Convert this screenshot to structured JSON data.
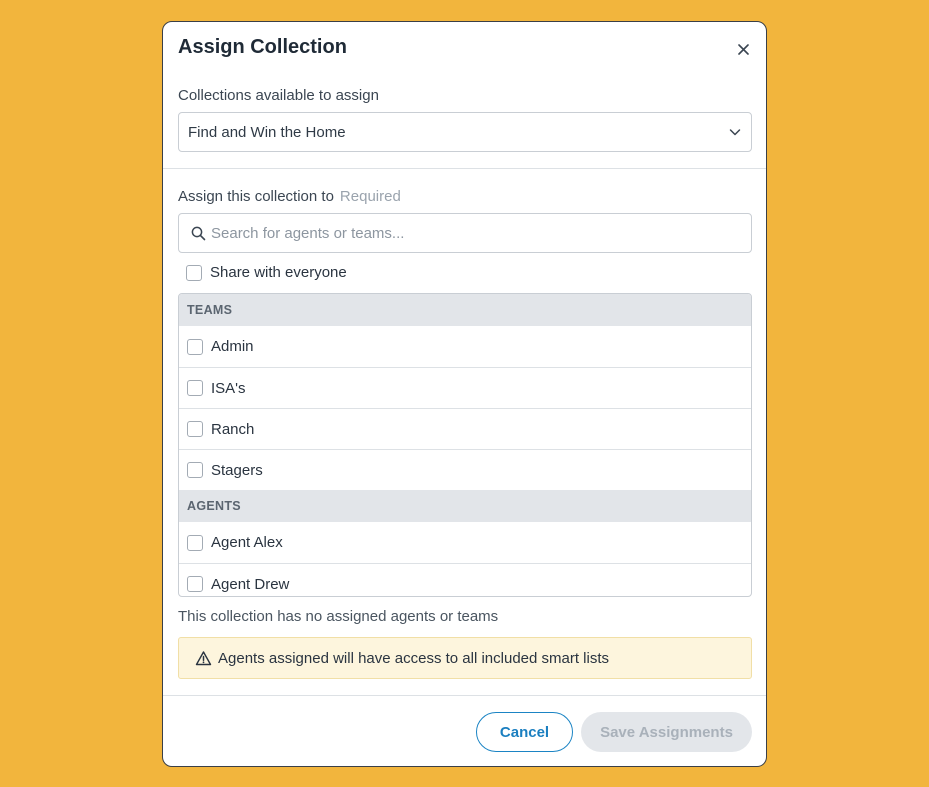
{
  "modal": {
    "title": "Assign Collection",
    "close_icon": "close-icon"
  },
  "collection_select": {
    "label": "Collections available to assign",
    "value": "Find and Win the Home",
    "icon": "chevron-down-icon"
  },
  "assign": {
    "label": "Assign this collection to",
    "required": "Required",
    "search_placeholder": "Search for agents or teams...",
    "search_value": "",
    "search_icon": "search-icon",
    "share_label": "Share with everyone"
  },
  "teams": {
    "header": "TEAMS",
    "items": [
      {
        "label": "Admin",
        "checked": false
      },
      {
        "label": "ISA's",
        "checked": false
      },
      {
        "label": "Ranch",
        "checked": false
      },
      {
        "label": "Stagers",
        "checked": false
      }
    ]
  },
  "agents": {
    "header": "AGENTS",
    "items": [
      {
        "label": "Agent Alex",
        "checked": false
      },
      {
        "label": "Agent Drew",
        "checked": false
      }
    ]
  },
  "status_text": "This collection has no assigned agents or teams",
  "warning": {
    "icon": "warning-icon",
    "text": "Agents assigned will have access to all included smart lists"
  },
  "footer": {
    "cancel_label": "Cancel",
    "save_label": "Save Assignments",
    "save_disabled": true
  },
  "colors": {
    "background": "#f2b53d",
    "accent": "#1b84c4",
    "warning_bg": "#fdf5dd",
    "disabled_bg": "#e3e6ea"
  }
}
